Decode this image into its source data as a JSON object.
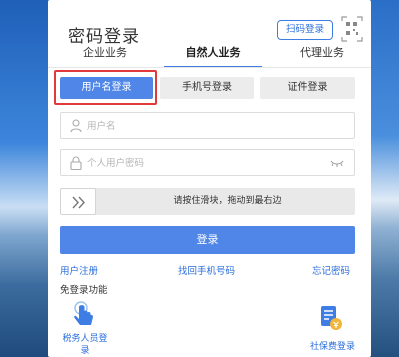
{
  "header": {
    "title": "密码登录",
    "scan_login": "扫码登录"
  },
  "business_tabs": [
    {
      "label": "企业业务",
      "active": false
    },
    {
      "label": "自然人业务",
      "active": true
    },
    {
      "label": "代理业务",
      "active": false
    }
  ],
  "login_tabs": [
    {
      "label": "用户名登录",
      "active": true
    },
    {
      "label": "手机号登录",
      "active": false
    },
    {
      "label": "证件登录",
      "active": false
    }
  ],
  "form": {
    "username_placeholder": "用户名",
    "password_placeholder": "个人用户密码",
    "slider_text": "请按住滑块，拖动到最右边",
    "login_button": "登录"
  },
  "links": {
    "register": "用户注册",
    "recover_phone": "找回手机号码",
    "forgot_password": "忘记密码"
  },
  "no_login": {
    "title": "免登录功能",
    "items": [
      {
        "label": "税务人员登录",
        "icon": "touch-hand-icon"
      },
      {
        "label": "社保费登录",
        "icon": "social-security-card-icon"
      }
    ]
  },
  "colors": {
    "accent": "#4f86e8",
    "link": "#2a6ddb",
    "highlight_frame": "#e23a3a"
  }
}
